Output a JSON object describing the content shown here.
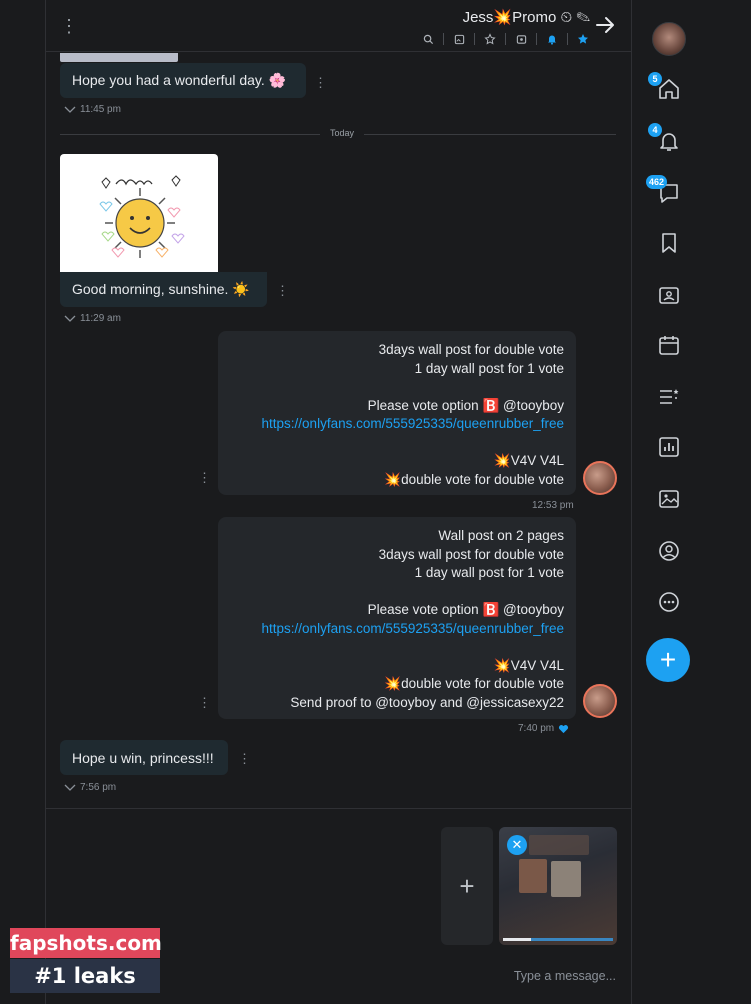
{
  "header": {
    "title": "Jess💥Promo ⏲ ✎",
    "icons": [
      "star-icon",
      "bell-icon",
      "media-icon",
      "tip-icon",
      "gallery-icon",
      "search-icon"
    ]
  },
  "messages": [
    {
      "id": "m1",
      "direction": "in",
      "text": "Hope you had a wonderful day. 🌸",
      "time": "11:45 pm"
    },
    {
      "id": "m2",
      "direction": "in",
      "image_caption": "Smile",
      "text": "Good morning, sunshine. ☀️",
      "time": "11:29 am"
    },
    {
      "id": "m3",
      "direction": "out",
      "lines": [
        "3days wall post for double vote",
        "1 day wall post for 1 vote",
        "",
        "Please vote option 🅱️ @tooyboy",
        "https://onlyfans.com/555925335/queenrubber_free",
        "",
        "💥V4V V4L",
        "💥double vote for double vote"
      ],
      "time": "12:53 pm"
    },
    {
      "id": "m4",
      "direction": "out",
      "lines": [
        "Wall post on 2 pages",
        "3days wall post for double vote",
        "1 day wall post for 1 vote",
        "",
        "Please vote option 🅱️ @tooyboy",
        "https://onlyfans.com/555925335/queenrubber_free",
        "",
        "💥V4V V4L",
        "💥double vote for double vote",
        "Send proof to @tooyboy and @jessicasexy22"
      ],
      "time": "7:40 pm",
      "liked": true
    },
    {
      "id": "m5",
      "direction": "in",
      "text": "Hope u win, princess!!!",
      "time": "7:56 pm"
    }
  ],
  "divider": {
    "label": "Today"
  },
  "composer": {
    "placeholder": "Type a message..."
  },
  "nav": {
    "items": [
      {
        "name": "home",
        "badge": "5"
      },
      {
        "name": "notifications",
        "badge": "4"
      },
      {
        "name": "messages",
        "badge": "462"
      },
      {
        "name": "bookmarks",
        "badge": ""
      },
      {
        "name": "collections",
        "badge": ""
      },
      {
        "name": "calendar",
        "badge": ""
      },
      {
        "name": "lists",
        "badge": ""
      },
      {
        "name": "statistics",
        "badge": ""
      },
      {
        "name": "vault",
        "badge": ""
      },
      {
        "name": "profile",
        "badge": ""
      },
      {
        "name": "more",
        "badge": ""
      }
    ],
    "fab_label": "+"
  },
  "watermark": {
    "line1": "fapshots.com",
    "line2": "#1 leaks"
  },
  "colors": {
    "accent": "#1da1f2",
    "bubble_in": "#1f2a30",
    "bubble_out": "#24272b",
    "background": "#1a1b1d"
  }
}
